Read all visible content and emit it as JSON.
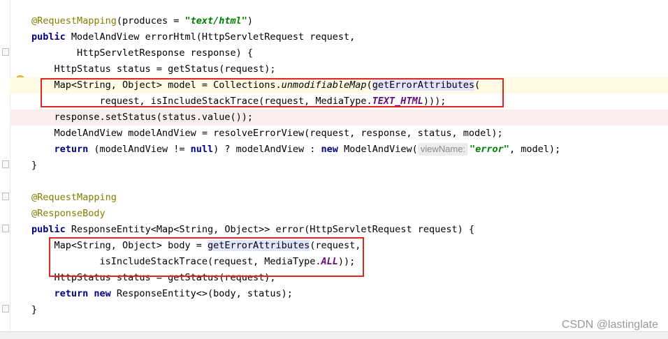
{
  "editor": {
    "lines": [
      {
        "parts": [
          [
            "ann",
            "@RequestMapping"
          ],
          [
            "",
            "(produces = "
          ],
          [
            "str",
            "\"text/html\""
          ],
          [
            "",
            ")"
          ]
        ]
      },
      {
        "parts": [
          [
            "kw",
            "public "
          ],
          [
            "",
            "ModelAndView errorHtml(HttpServletRequest request,"
          ]
        ]
      },
      {
        "parts": [
          [
            "",
            "        HttpServletResponse response) {"
          ]
        ]
      },
      {
        "parts": [
          [
            "",
            "    HttpStatus status = getStatus(request);"
          ]
        ]
      },
      {
        "parts": [
          [
            "",
            "    Map<String, Object> model = Collections."
          ],
          [
            "it",
            "unmodifiableMap"
          ],
          [
            "",
            "("
          ],
          [
            "mth",
            "getErrorAttributes"
          ],
          [
            "",
            "("
          ]
        ]
      },
      {
        "parts": [
          [
            "",
            "            request, isIncludeStackTrace(request, MediaType."
          ],
          [
            "cst",
            "TEXT_HTML"
          ],
          [
            "",
            ")));"
          ]
        ]
      },
      {
        "parts": [
          [
            "",
            "    response.setStatus(status.value());"
          ]
        ]
      },
      {
        "parts": [
          [
            "",
            "    ModelAndView modelAndView = resolveErrorView(request, response, status, model);"
          ]
        ]
      },
      {
        "parts": [
          [
            "",
            "    "
          ],
          [
            "kw",
            "return "
          ],
          [
            "",
            "(modelAndView != "
          ],
          [
            "kw",
            "null"
          ],
          [
            "",
            ") ? modelAndView : "
          ],
          [
            "kw",
            "new "
          ],
          [
            "",
            "ModelAndView("
          ],
          [
            "hint",
            "viewName:"
          ],
          [
            "str",
            "\"error\""
          ],
          [
            "",
            ", model);"
          ]
        ]
      },
      {
        "parts": [
          [
            "",
            "}"
          ]
        ]
      },
      {
        "parts": [
          [
            "",
            ""
          ]
        ]
      },
      {
        "parts": [
          [
            "ann",
            "@RequestMapping"
          ]
        ]
      },
      {
        "parts": [
          [
            "ann",
            "@ResponseBody"
          ]
        ]
      },
      {
        "parts": [
          [
            "kw",
            "public "
          ],
          [
            "",
            "ResponseEntity<Map<String, Object>> error(HttpServletRequest request) {"
          ]
        ]
      },
      {
        "parts": [
          [
            "",
            "    Map<String, Object> body = "
          ],
          [
            "mth",
            "getErrorAttributes"
          ],
          [
            "",
            "(request,"
          ]
        ]
      },
      {
        "parts": [
          [
            "",
            "            isIncludeStackTrace(request, MediaType."
          ],
          [
            "cst",
            "ALL"
          ],
          [
            "",
            "));"
          ]
        ]
      },
      {
        "parts": [
          [
            "",
            "    HttpStatus status = getStatus(request);"
          ]
        ]
      },
      {
        "parts": [
          [
            "",
            "    "
          ],
          [
            "kw",
            "return new "
          ],
          [
            "",
            "ResponseEntity<>(body, status);"
          ]
        ]
      },
      {
        "parts": [
          [
            "",
            "}"
          ]
        ]
      }
    ]
  },
  "watermark": "CSDN @lastinglate",
  "colors": {
    "annotation": "#808000",
    "keyword": "#000080",
    "string": "#008000",
    "constant": "#660e7a",
    "highlight_box": "#e02525"
  },
  "icons": [
    "intention-bulb-icon",
    "fold-marker-icon"
  ]
}
